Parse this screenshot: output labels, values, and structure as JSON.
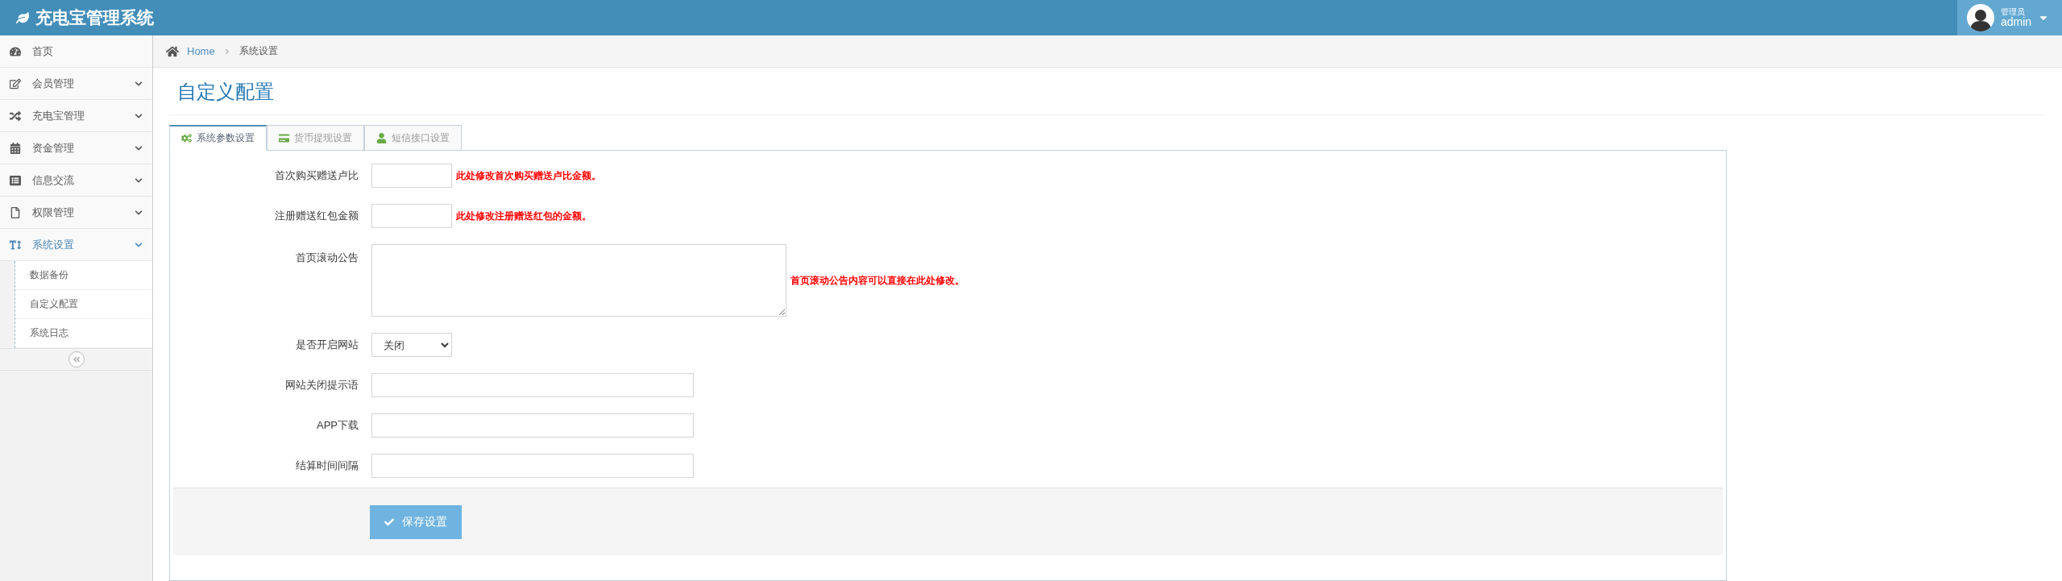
{
  "header": {
    "title": "充电宝管理系统",
    "user": {
      "role": "管理员",
      "name": "admin"
    }
  },
  "sidebar": {
    "items": [
      {
        "label": "首页",
        "selected": false
      },
      {
        "label": "会员管理",
        "selected": false,
        "expanded": false
      },
      {
        "label": "充电宝管理",
        "selected": false,
        "expanded": false
      },
      {
        "label": "资金管理",
        "selected": false,
        "expanded": false
      },
      {
        "label": "信息交流",
        "selected": false,
        "expanded": false
      },
      {
        "label": "权限管理",
        "selected": false,
        "expanded": false
      },
      {
        "label": "系统设置",
        "selected": true,
        "expanded": true,
        "children": [
          {
            "label": "数据备份"
          },
          {
            "label": "自定义配置"
          },
          {
            "label": "系统日志"
          }
        ]
      }
    ]
  },
  "breadcrumb": [
    "Home",
    "系统设置"
  ],
  "page_title": "自定义配置",
  "tabs": [
    {
      "label": "系统参数设置",
      "selected": true
    },
    {
      "label": "货币提现设置",
      "selected": false
    },
    {
      "label": "短信接口设置",
      "selected": false
    }
  ],
  "form": {
    "fields": [
      {
        "kind": "short",
        "label": "首次购买赠送卢比",
        "hint": "此处修改首次购买赠送卢比金额。"
      },
      {
        "kind": "short",
        "label": "注册赠送红包金额",
        "hint": "此处修改注册赠送红包的金额。"
      },
      {
        "kind": "textarea",
        "label": "首页滚动公告",
        "hint": "首页滚动公告内容可以直接在此处修改。"
      },
      {
        "kind": "select",
        "label": "是否开启网站",
        "value": "关闭"
      },
      {
        "kind": "long",
        "label": "网站关闭提示语"
      },
      {
        "kind": "long",
        "label": "APP下载"
      },
      {
        "kind": "long",
        "label": "结算时间间隔"
      }
    ],
    "submit": "保存设置"
  }
}
